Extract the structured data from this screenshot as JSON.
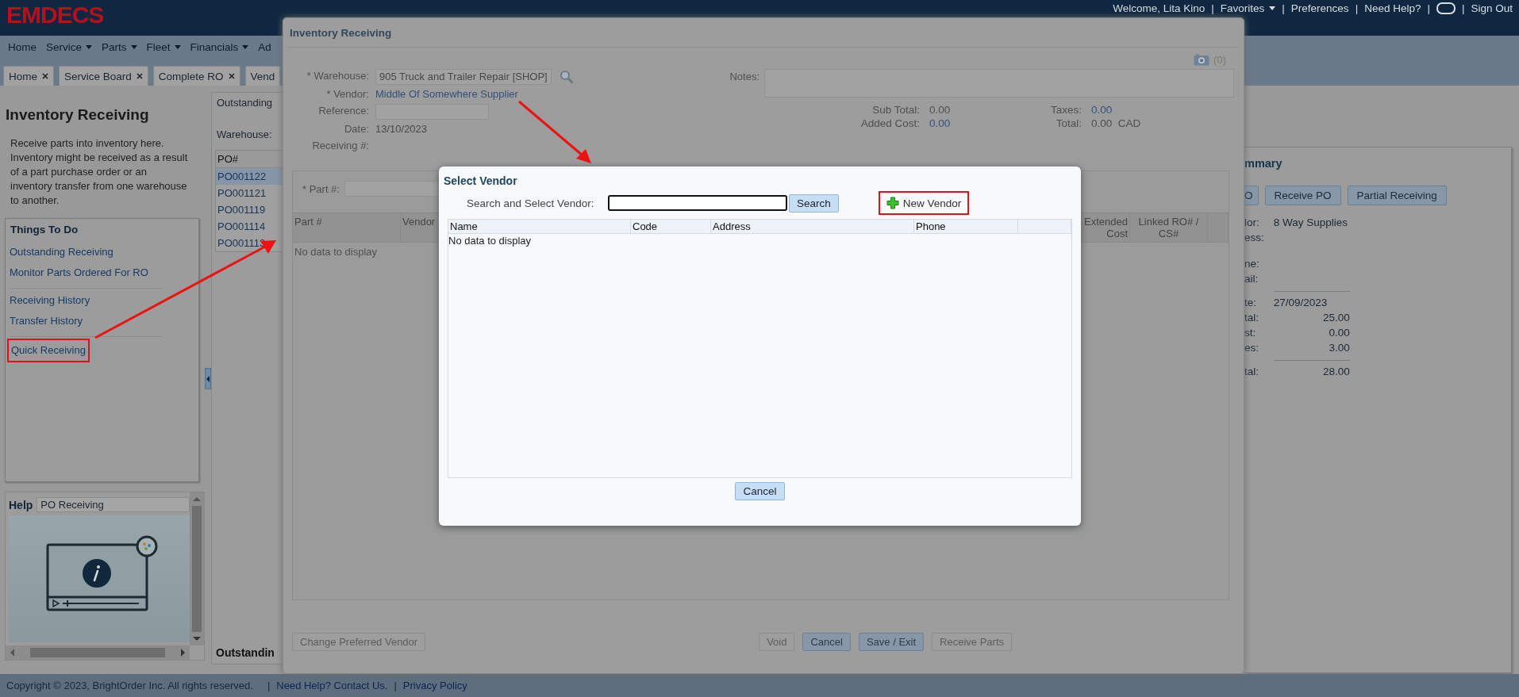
{
  "header": {
    "logo": "EMDECS",
    "items": [
      {
        "kind": "text",
        "text": "Welcome, Lita Kino"
      },
      {
        "kind": "separator",
        "text": "|"
      },
      {
        "kind": "menu",
        "text": "Favorites"
      },
      {
        "kind": "separator",
        "text": "|"
      },
      {
        "kind": "link",
        "text": "Preferences"
      },
      {
        "kind": "separator",
        "text": "|"
      },
      {
        "kind": "link",
        "text": "Need Help?"
      },
      {
        "kind": "separator",
        "text": "|"
      },
      {
        "kind": "icon"
      },
      {
        "kind": "separator",
        "text": "|"
      },
      {
        "kind": "link",
        "text": "Sign Out"
      }
    ]
  },
  "nav": [
    {
      "label": "Home",
      "has_menu": false
    },
    {
      "label": "Service",
      "has_menu": true
    },
    {
      "label": "Parts",
      "has_menu": true
    },
    {
      "label": "Fleet",
      "has_menu": true
    },
    {
      "label": "Financials",
      "has_menu": true
    },
    {
      "label": "Ad",
      "has_menu": false
    }
  ],
  "tabs": [
    {
      "label": "Home",
      "closable": true,
      "selected": false
    },
    {
      "label": "Service Board",
      "closable": true,
      "selected": false
    },
    {
      "label": "Complete RO",
      "closable": true,
      "selected": false
    },
    {
      "label": "Vend",
      "closable": false,
      "selected": false
    }
  ],
  "sidebar": {
    "title": "Inventory Receiving",
    "description": "Receive parts into inventory here. Inventory might be received as a result of a part purchase order or an inventory transfer from one warehouse to another.",
    "todo": {
      "title": "Things To Do",
      "groups": [
        [
          {
            "label": "Outstanding Receiving",
            "highlighted": false
          },
          {
            "label": "Monitor Parts Ordered For RO",
            "highlighted": false
          }
        ],
        [
          {
            "label": "Receiving History",
            "highlighted": false
          },
          {
            "label": "Transfer History",
            "highlighted": false
          }
        ],
        [
          {
            "label": "Quick Receiving",
            "highlighted": true
          }
        ]
      ]
    },
    "help": {
      "title": "Help",
      "topic": "PO Receiving"
    }
  },
  "outstanding": {
    "title": "Outstanding",
    "warehouse_label": "Warehouse:",
    "column": "PO#",
    "rows": [
      {
        "po": "PO001122",
        "selected": true
      },
      {
        "po": "PO001121",
        "selected": false
      },
      {
        "po": "PO001119",
        "selected": false
      },
      {
        "po": "PO001114",
        "selected": false
      },
      {
        "po": "PO001113",
        "selected": false
      }
    ],
    "footer_title": "Outstandin"
  },
  "summary": {
    "title": "mmary",
    "buttons": [
      "O",
      "Receive PO",
      "Partial Receiving"
    ],
    "fields": [
      {
        "kind": "field",
        "label": "lor:",
        "value": "8 Way Supplies"
      },
      {
        "kind": "field",
        "label": "ess:"
      },
      {
        "kind": "gap"
      },
      {
        "kind": "field",
        "label": "ne:"
      },
      {
        "kind": "field",
        "label": "ail:"
      },
      {
        "kind": "rule"
      },
      {
        "kind": "field",
        "label": "te:",
        "value": "27/09/2023"
      },
      {
        "kind": "amount",
        "label": "tal:",
        "value": "25.00"
      },
      {
        "kind": "amount",
        "label": "st:",
        "value": "0.00"
      },
      {
        "kind": "amount",
        "label": "es:",
        "value": "3.00"
      },
      {
        "kind": "rule"
      },
      {
        "kind": "amount",
        "label": "tal:",
        "value": "28.00"
      }
    ]
  },
  "inventory_window": {
    "title": "Inventory Receiving",
    "attachments": "(0)",
    "fields": [
      {
        "kind": "select",
        "label": "* Warehouse:",
        "value": "905 Truck and Trailer Repair [SHOP]"
      },
      {
        "kind": "link",
        "label": "* Vendor:",
        "value": "Middle Of Somewhere Supplier"
      },
      {
        "kind": "input",
        "label": "Reference:"
      },
      {
        "kind": "text",
        "label": "Date:",
        "value": "13/10/2023"
      },
      {
        "kind": "text",
        "label": "Receiving #:"
      }
    ],
    "notes_label": "Notes:",
    "totals": [
      {
        "label": "Sub Total:",
        "value": "0.00",
        "link": false
      },
      {
        "label": "Taxes:",
        "value": "0.00",
        "link": true
      },
      {
        "label": "Added Cost:",
        "value": "0.00",
        "link": true
      },
      {
        "label": "Total:",
        "value": "0.00",
        "link": false,
        "currency": "CAD"
      }
    ],
    "part_label": "* Part #:",
    "columns": [
      "Part #",
      "Vendor",
      "Extended Cost",
      "Linked RO# / CS#"
    ],
    "empty_text": "No data to display",
    "buttons": [
      {
        "label": "Change Preferred Vendor",
        "disabled": true
      },
      {
        "label": "Void",
        "disabled": true
      },
      {
        "label": "Cancel",
        "disabled": false
      },
      {
        "label": "Save / Exit",
        "disabled": false
      },
      {
        "label": "Receive Parts",
        "disabled": true
      }
    ]
  },
  "dialog": {
    "title": "Select Vendor",
    "search_label": "Search and Select Vendor:",
    "search_button": "Search",
    "new_vendor": {
      "label": "New Vendor",
      "highlighted": true
    },
    "columns": [
      "Name",
      "Code",
      "Address",
      "Phone"
    ],
    "empty_text": "No data to display",
    "cancel": "Cancel"
  },
  "footer": {
    "copyright": "Copyright © 2023, BrightOrder Inc. All rights reserved.",
    "separator": "|",
    "links": [
      "Need Help? Contact Us.",
      "Privacy Policy"
    ]
  }
}
